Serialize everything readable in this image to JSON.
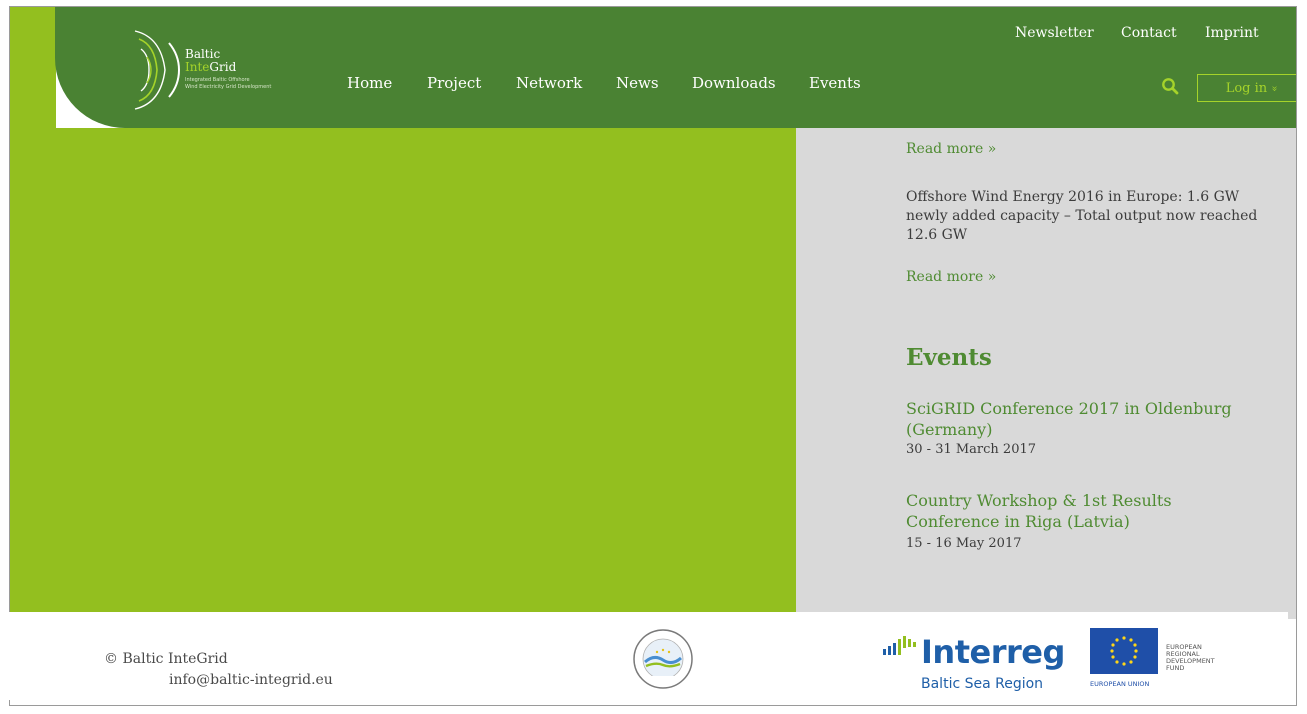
{
  "logo": {
    "name_line1": "Baltic",
    "name_line2_accent": "Inte",
    "name_line2_rest": "Grid",
    "tagline_line1": "Integrated Baltic Offshore",
    "tagline_line2": "Wind Electricity Grid Development"
  },
  "top_nav": {
    "newsletter": "Newsletter",
    "contact": "Contact",
    "imprint": "Imprint"
  },
  "main_nav": [
    "Home",
    "Project",
    "Network",
    "News",
    "Downloads",
    "Events"
  ],
  "login": {
    "label": "Log in",
    "chevron": "»"
  },
  "news": {
    "read_more_1": "Read more »",
    "item_text": "Offshore Wind Energy 2016 in Europe: 1.6 GW newly added capacity – Total output now reached 12.6 GW",
    "read_more_2": "Read more »"
  },
  "events": {
    "heading": "Events",
    "items": [
      {
        "title": "SciGRID Conference 2017 in Oldenburg (Germany)",
        "date": "30 - 31 March 2017"
      },
      {
        "title": "Country Workshop & 1st Results Conference in Riga (Latvia)",
        "date": "15 - 16 May 2017"
      }
    ]
  },
  "footer": {
    "copyright": "© Baltic InteGrid",
    "email": "info@baltic-integrid.eu",
    "interreg_word": "Interreg",
    "interreg_sub": "Baltic Sea Region",
    "eu_fund_lines": [
      "EUROPEAN",
      "REGIONAL",
      "DEVELOPMENT",
      "FUND"
    ],
    "eu_union": "EUROPEAN UNION"
  },
  "colors": {
    "header_green": "#4a8233",
    "lime": "#93bf1f",
    "panel_grey": "#d9d9d9",
    "link_green": "#4f8b32",
    "interreg_blue": "#1f5fa8"
  }
}
